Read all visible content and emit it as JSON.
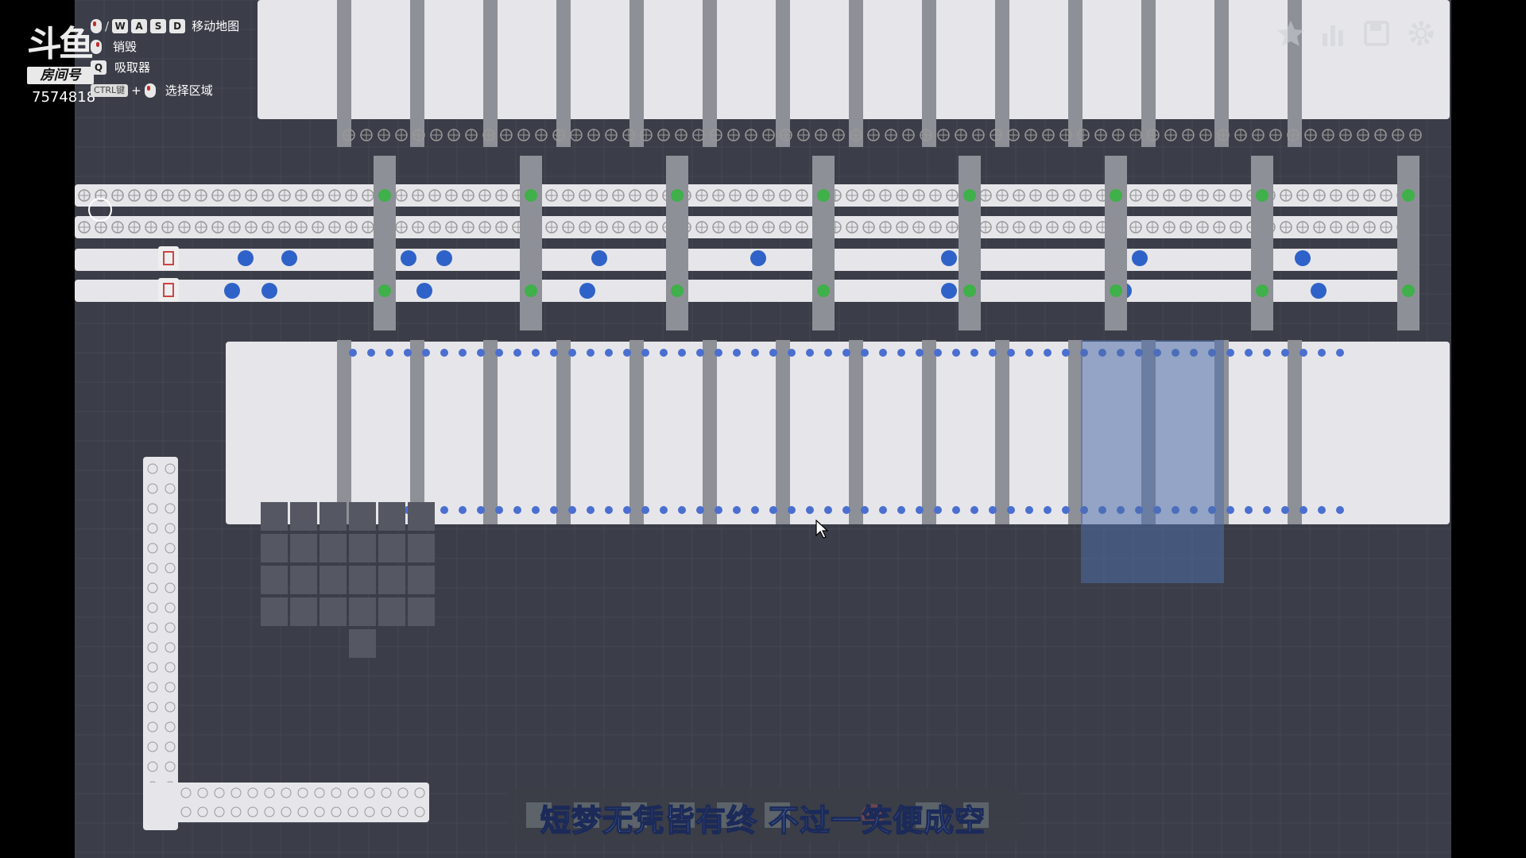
{
  "hud": {
    "logo_text": "斗鱼",
    "room_label": "房间号",
    "room_number": "7574818",
    "controls": [
      {
        "keys": [
          "W",
          "A",
          "S",
          "D"
        ],
        "label": "移动地图"
      },
      {
        "keys": [],
        "label": "销毁"
      },
      {
        "keys": [],
        "label": "吸取器"
      },
      {
        "keys": [
          "CTRL键"
        ],
        "label": "选择区域"
      }
    ],
    "top_buttons": [
      "star-icon",
      "chart-icon",
      "save-icon",
      "settings-icon"
    ]
  },
  "subtitle": {
    "text": "短梦无凭皆有终 不过一笑便成空"
  },
  "colors": {
    "background": "#3b3e48",
    "belt": "#e6e6ea",
    "machine": "#8e9097",
    "pin_blue": "#2f62c8",
    "pin_green": "#3fb04a",
    "selection": "#4f6ea8",
    "subtitle_fill": "#7aa2f0"
  }
}
